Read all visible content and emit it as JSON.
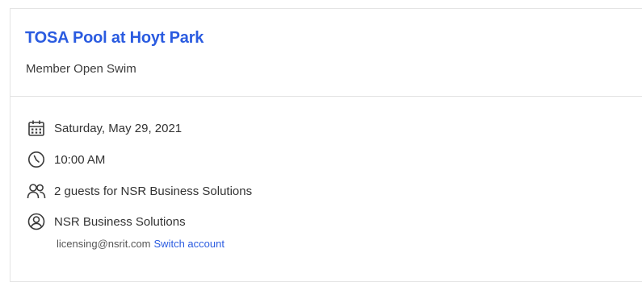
{
  "event": {
    "venue": "TOSA Pool at Hoyt Park",
    "session": "Member Open Swim"
  },
  "details": {
    "date": "Saturday, May 29, 2021",
    "time": "10:00 AM",
    "guests": "2 guests for NSR Business Solutions",
    "account_name": "NSR Business Solutions",
    "account_email": "licensing@nsrit.com",
    "switch_account_label": "Switch account"
  },
  "icons": {
    "date": "calendar-icon",
    "time": "clock-icon",
    "guests": "people-icon",
    "account": "user-circle-icon"
  },
  "colors": {
    "accent": "#2a5be0",
    "text": "#333333",
    "divider": "#e2e2e2"
  }
}
